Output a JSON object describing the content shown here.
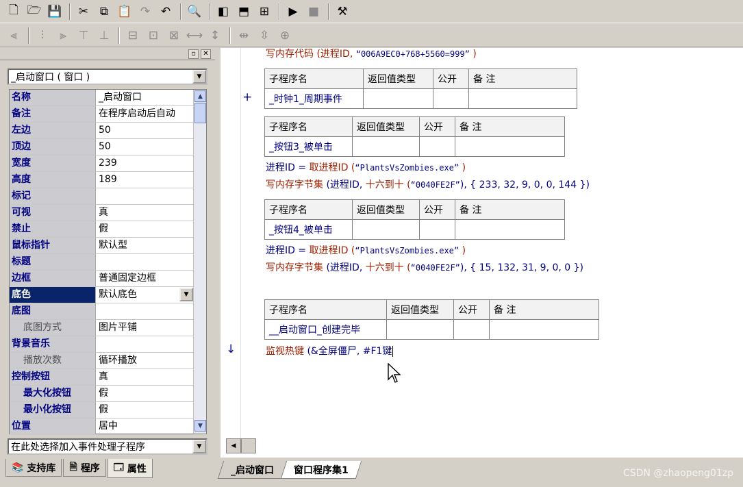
{
  "toolbar1": {
    "buttons": [
      {
        "name": "new-file-icon",
        "glyph": "🗋"
      },
      {
        "name": "open-file-icon",
        "glyph": "🗁"
      },
      {
        "name": "save-icon",
        "glyph": "💾"
      },
      {
        "name": "cut-icon",
        "glyph": "✂"
      },
      {
        "name": "copy-icon",
        "glyph": "⧉"
      },
      {
        "name": "paste-icon",
        "glyph": "📋"
      },
      {
        "name": "redo-icon",
        "glyph": "↷"
      },
      {
        "name": "undo-icon",
        "glyph": "↶"
      },
      {
        "name": "find-icon",
        "glyph": "🔍"
      },
      {
        "name": "layout-left-icon",
        "glyph": "◧"
      },
      {
        "name": "layout-top-icon",
        "glyph": "⬒"
      },
      {
        "name": "layout-split-icon",
        "glyph": "⊞"
      },
      {
        "name": "run-icon",
        "glyph": "▶"
      },
      {
        "name": "stop-icon",
        "glyph": "■"
      },
      {
        "name": "debug-icon",
        "glyph": "⚒"
      }
    ]
  },
  "toolbar2": {
    "buttons": [
      "align-left-icon",
      "align-center-icon",
      "align-right-icon",
      "align-top-icon",
      "align-middle-icon",
      "align-bottom-icon",
      "same-width-icon",
      "same-height-icon",
      "same-size-icon",
      "h-space-icon",
      "v-space-icon",
      "center-h-icon",
      "center-v-icon"
    ]
  },
  "left_panel": {
    "object_selector": "_启动窗口 ( 窗口 )",
    "properties": [
      {
        "name": "名称",
        "value": "_启动窗口",
        "style": ""
      },
      {
        "name": "备注",
        "value": "在程序启动后自动",
        "style": ""
      },
      {
        "name": "左边",
        "value": "50",
        "style": ""
      },
      {
        "name": "顶边",
        "value": "50",
        "style": ""
      },
      {
        "name": "宽度",
        "value": "239",
        "style": ""
      },
      {
        "name": "高度",
        "value": "189",
        "style": ""
      },
      {
        "name": "标记",
        "value": "",
        "style": ""
      },
      {
        "name": "可视",
        "value": "真",
        "style": ""
      },
      {
        "name": "禁止",
        "value": "假",
        "style": ""
      },
      {
        "name": "鼠标指针",
        "value": "默认型",
        "style": ""
      },
      {
        "name": "标题",
        "value": "",
        "style": ""
      },
      {
        "name": "边框",
        "value": "普通固定边框",
        "style": ""
      },
      {
        "name": "底色",
        "value": "默认底色",
        "style": "sel"
      },
      {
        "name": "底图",
        "value": "",
        "style": ""
      },
      {
        "name": "底图方式",
        "value": "图片平铺",
        "style": "sub1"
      },
      {
        "name": "背景音乐",
        "value": "",
        "style": ""
      },
      {
        "name": "播放次数",
        "value": "循环播放",
        "style": "sub1"
      },
      {
        "name": "控制按钮",
        "value": "真",
        "style": ""
      },
      {
        "name": "最大化按钮",
        "value": "假",
        "style": "sub2"
      },
      {
        "name": "最小化按钮",
        "value": "假",
        "style": "sub2"
      },
      {
        "name": "位置",
        "value": "居中",
        "style": ""
      }
    ],
    "event_selector": "在此处选择加入事件处理子程序",
    "tabs": [
      "支持库",
      "程序",
      "属性"
    ]
  },
  "editor": {
    "lines": {
      "l1_func": "写内存代码",
      "l1_args_open": " (进程ID, ",
      "l1_str": "“006A9EC0+768+5560=999”",
      "l1_close": " )",
      "l2_var": "进程ID",
      "l2_eq": " = ",
      "l2_func": "取进程ID",
      "l2_open": " (",
      "l2_str": "“PlantsVsZombies.exe”",
      "l2_close": " )",
      "l3_func": "写内存字节集",
      "l3_open": " (进程ID, ",
      "l3_func2": "十六到十",
      "l3_open2": " (",
      "l3_str": "“0040FE2F”",
      "l3_tail": "), { 233, 32, 9, 0, 0, 144 })",
      "l4_var": "进程ID",
      "l4_eq": " = ",
      "l4_func": "取进程ID",
      "l4_open": " (",
      "l4_str": "“PlantsVsZombies.exe”",
      "l4_close": " )",
      "l5_func": "写内存字节集",
      "l5_open": " (进程ID, ",
      "l5_func2": "十六到十",
      "l5_open2": " (",
      "l5_str": "“0040FE2F”",
      "l5_tail": "), { 15, 132, 31, 9, 0, 0 })",
      "l6_func": "监视热键",
      "l6_args": " (&全屏僵尸, #F1键"
    },
    "table_header": {
      "name": "子程序名",
      "ret": "返回值类型",
      "pub": "公开",
      "note": "备 注"
    },
    "subs": [
      "_时钟1_周期事件",
      "_按钮3_被单击",
      "_按钮4_被单击",
      "__启动窗口_创建完毕"
    ],
    "tabs": [
      "_启动窗口",
      "窗口程序集1"
    ]
  },
  "watermark": "CSDN @zhaopeng01zp"
}
